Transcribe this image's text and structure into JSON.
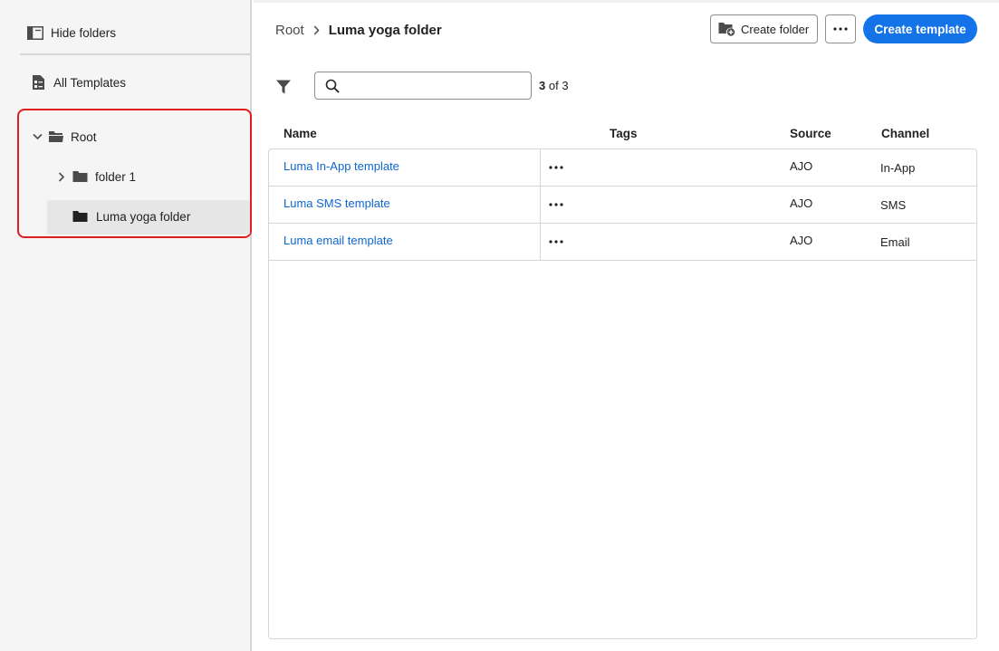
{
  "sidebar": {
    "hide_folders_label": "Hide folders",
    "all_templates_label": "All Templates",
    "tree": {
      "root_label": "Root",
      "children": [
        {
          "label": "folder 1"
        },
        {
          "label": "Luma yoga folder"
        }
      ]
    }
  },
  "header": {
    "breadcrumb": {
      "root": "Root",
      "current": "Luma yoga folder"
    },
    "create_folder_label": "Create folder",
    "create_template_label": "Create template"
  },
  "toolbar": {
    "search": {
      "value": "",
      "placeholder": ""
    },
    "count_shown": "3",
    "count_total": "of 3"
  },
  "table": {
    "headers": {
      "name": "Name",
      "tags": "Tags",
      "source": "Source",
      "channel": "Channel"
    },
    "rows": [
      {
        "name": "Luma In-App template",
        "source": "AJO",
        "channel": "In-App"
      },
      {
        "name": "Luma SMS template",
        "source": "AJO",
        "channel": "SMS"
      },
      {
        "name": "Luma email template",
        "source": "AJO",
        "channel": "Email"
      }
    ]
  },
  "colors": {
    "accent": "#1473e6",
    "link": "#0d66d0",
    "highlight_border": "#e01e1e",
    "sidebar_bg": "#f5f5f5",
    "selected_bg": "#e6e6e6"
  },
  "icons": [
    "panel-icon",
    "document-icon",
    "chevron-down-icon",
    "folder-open-icon",
    "chevron-right-icon",
    "folder-icon",
    "folder-add-icon",
    "more-icon",
    "filter-icon",
    "search-icon"
  ]
}
